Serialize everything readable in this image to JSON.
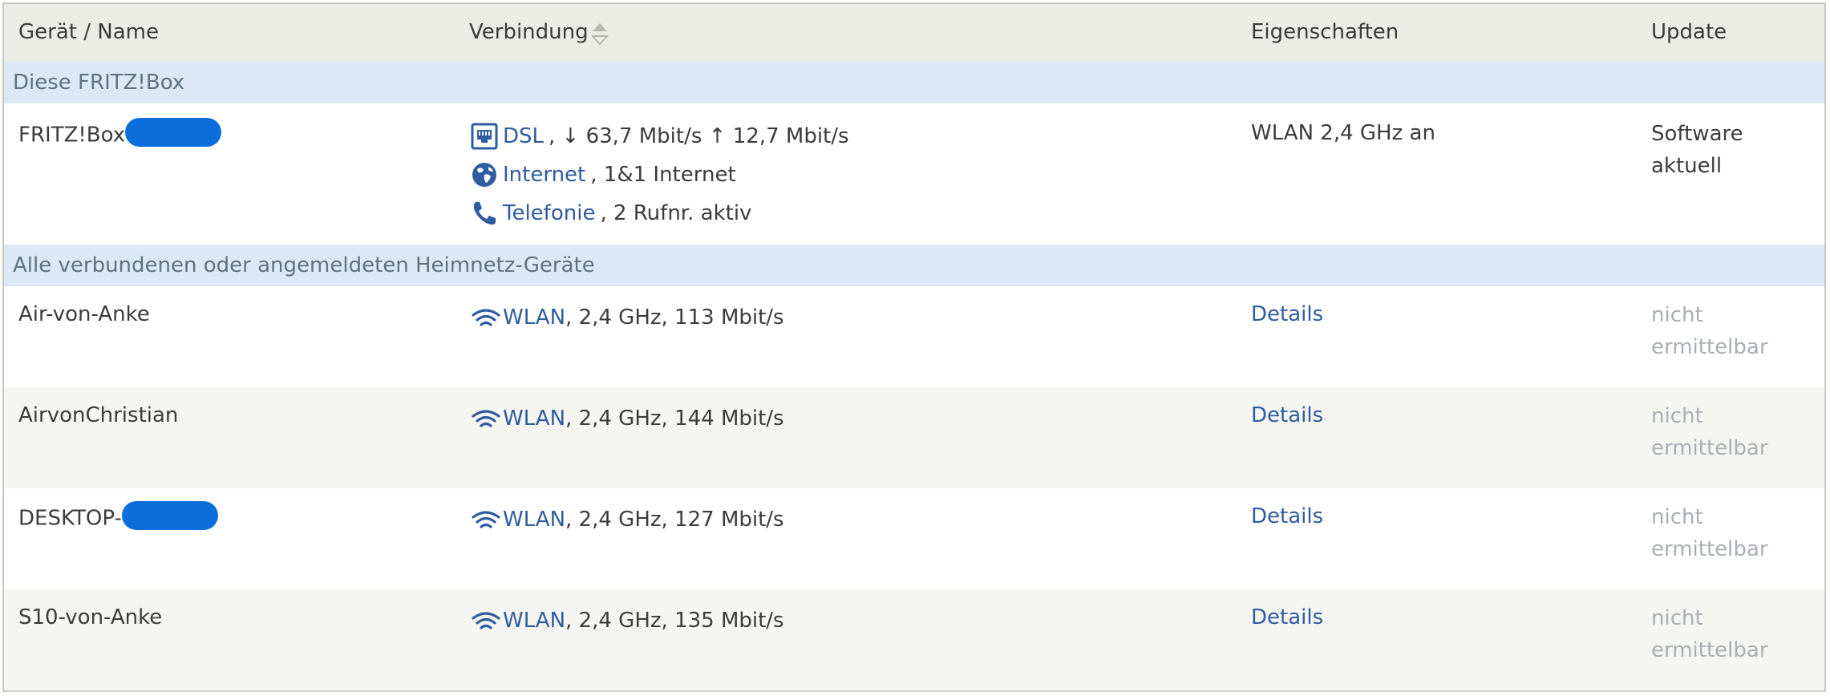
{
  "colors": {
    "header_bg": "#ecece7",
    "section_bg": "#dce8f5",
    "link": "#2e5ca0",
    "muted": "#a9afb4",
    "redaction": "#0a6fdc"
  },
  "header": {
    "device": "Gerät / Name",
    "connection": "Verbindung",
    "properties": "Eigenschaften",
    "update": "Update"
  },
  "section_fritzbox": {
    "label": "Diese FRITZ!Box"
  },
  "fritzbox": {
    "name": "FRITZ!Box",
    "dsl_link": "DSL",
    "dsl_detail": ", ↓ 63,7 Mbit/s ↑ 12,7 Mbit/s",
    "internet_link": "Internet",
    "internet_detail": ", 1&1 Internet",
    "phone_link": "Telefonie",
    "phone_detail": ", 2 Rufnr. aktiv",
    "properties": "WLAN 2,4 GHz an",
    "update_line1": "Software",
    "update_line2": "aktuell"
  },
  "section_devices": {
    "label": "Alle verbundenen oder angemeldeten Heimnetz-Geräte"
  },
  "devices": [
    {
      "name": "Air-von-Anke",
      "conn_link": "WLAN",
      "conn_detail": ", 2,4 GHz, 113 Mbit/s",
      "details": "Details",
      "update_line1": "nicht",
      "update_line2": "ermittelbar"
    },
    {
      "name": "AirvonChristian",
      "conn_link": "WLAN",
      "conn_detail": ", 2,4 GHz, 144 Mbit/s",
      "details": "Details",
      "update_line1": "nicht",
      "update_line2": "ermittelbar"
    },
    {
      "name": "DESKTOP-",
      "conn_link": "WLAN",
      "conn_detail": ", 2,4 GHz, 127 Mbit/s",
      "details": "Details",
      "update_line1": "nicht",
      "update_line2": "ermittelbar"
    },
    {
      "name": "S10-von-Anke",
      "conn_link": "WLAN",
      "conn_detail": ", 2,4 GHz, 135 Mbit/s",
      "details": "Details",
      "update_line1": "nicht",
      "update_line2": "ermittelbar"
    }
  ]
}
